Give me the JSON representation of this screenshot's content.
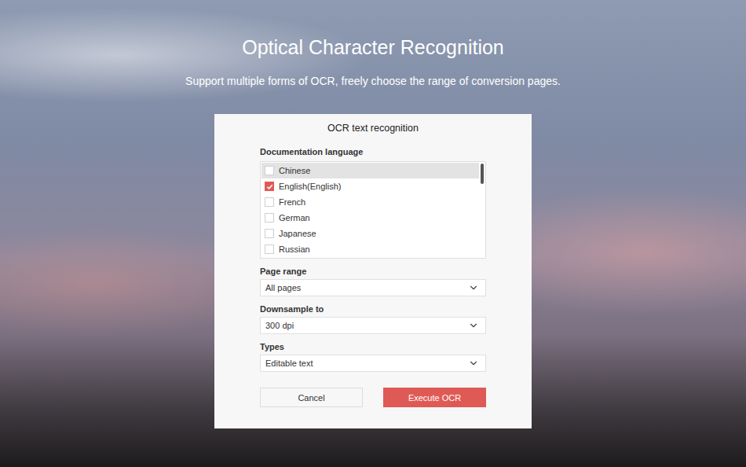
{
  "page": {
    "title": "Optical Character Recognition",
    "subtitle": "Support multiple forms of OCR, freely choose the range of conversion pages."
  },
  "dialog": {
    "title": "OCR text recognition",
    "language_label": "Documentation language",
    "languages": [
      {
        "label": "Chinese",
        "checked": false,
        "selected": true
      },
      {
        "label": "English(English)",
        "checked": true,
        "selected": false
      },
      {
        "label": "French",
        "checked": false,
        "selected": false
      },
      {
        "label": "German",
        "checked": false,
        "selected": false
      },
      {
        "label": "Japanese",
        "checked": false,
        "selected": false
      },
      {
        "label": "Russian",
        "checked": false,
        "selected": false
      }
    ],
    "fields": [
      {
        "label": "Page range",
        "value": "All pages"
      },
      {
        "label": "Downsample to",
        "value": "300 dpi"
      },
      {
        "label": "Types",
        "value": "Editable text"
      }
    ],
    "buttons": [
      {
        "label": "Cancel",
        "kind": "secondary"
      },
      {
        "label": "Execute OCR",
        "kind": "primary"
      }
    ]
  }
}
